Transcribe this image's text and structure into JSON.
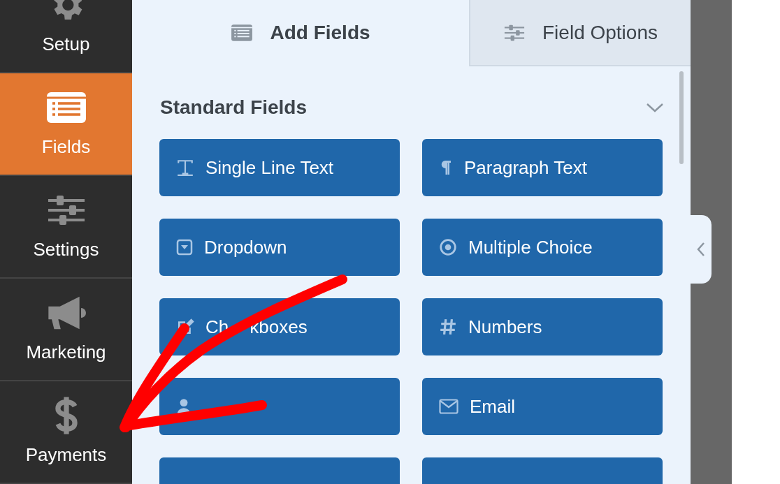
{
  "sidebar": {
    "items": [
      {
        "label": "Setup",
        "selected": false
      },
      {
        "label": "Fields",
        "selected": true
      },
      {
        "label": "Settings",
        "selected": false
      },
      {
        "label": "Marketing",
        "selected": false
      },
      {
        "label": "Payments",
        "selected": false
      }
    ]
  },
  "tabs": [
    {
      "label": "Add Fields",
      "selected": true
    },
    {
      "label": "Field Options",
      "selected": false
    }
  ],
  "section": {
    "title": "Standard Fields",
    "expanded": true
  },
  "fields": [
    {
      "kind": "field",
      "label": "Single Line Text"
    },
    {
      "kind": "field",
      "label": "Paragraph Text"
    },
    {
      "kind": "field",
      "label": "Dropdown"
    },
    {
      "kind": "field",
      "label": "Multiple Choice"
    },
    {
      "kind": "partly_covered",
      "label_parts": [
        "Ch",
        "kboxes"
      ]
    },
    {
      "kind": "field",
      "label": "Numbers"
    },
    {
      "kind": "covered"
    },
    {
      "kind": "field",
      "label": "Email"
    },
    {
      "kind": "cut_off"
    },
    {
      "kind": "cut_off"
    }
  ],
  "annotation": {
    "kind": "arrow"
  }
}
